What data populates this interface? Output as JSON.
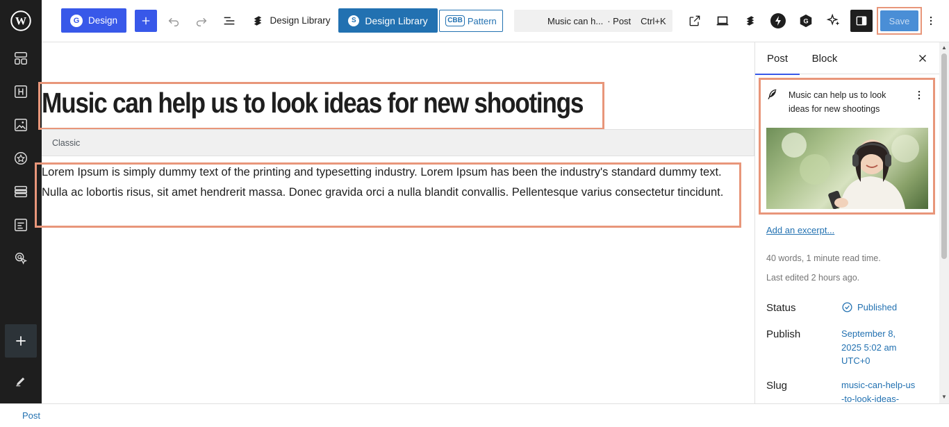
{
  "toolbar": {
    "design_label": "Design",
    "design_library_label": "Design Library",
    "design_library_active_label": "Design Library",
    "pattern_badge": "CBB",
    "pattern_label": "Pattern",
    "command_title": "Music can h...",
    "command_type": "· Post",
    "command_shortcut": "Ctrl+K",
    "save_label": "Save"
  },
  "editor": {
    "post_title": "Music can help us to look ideas for new shootings",
    "classic_label": "Classic",
    "paragraph": "Lorem Ipsum is simply dummy text of the printing and typesetting industry. Lorem Ipsum has been the industry's standard dummy text. Nulla ac lobortis risus, sit amet hendrerit massa. Donec gravida orci a nulla blandit convallis. Pellentesque varius consectetur tincidunt."
  },
  "panel": {
    "tab_post": "Post",
    "tab_block": "Block",
    "card_title": "Music can help us to look ideas for new shootings",
    "excerpt_link": "Add an excerpt...",
    "word_count": "40 words, 1 minute read time.",
    "last_edited": "Last edited 2 hours ago.",
    "status_label": "Status",
    "status_value": "Published",
    "publish_label": "Publish",
    "publish_value": "September 8, 2025 5:02 am UTC+0",
    "slug_label": "Slug",
    "slug_value": "music-can-help-us-to-look-ideas-"
  },
  "footer": {
    "breadcrumb": "Post"
  },
  "colors": {
    "accent": "#3858e9",
    "wp_blue": "#2271b1",
    "highlight": "#e8967a",
    "sidebar_bg": "#1e1e1e"
  }
}
